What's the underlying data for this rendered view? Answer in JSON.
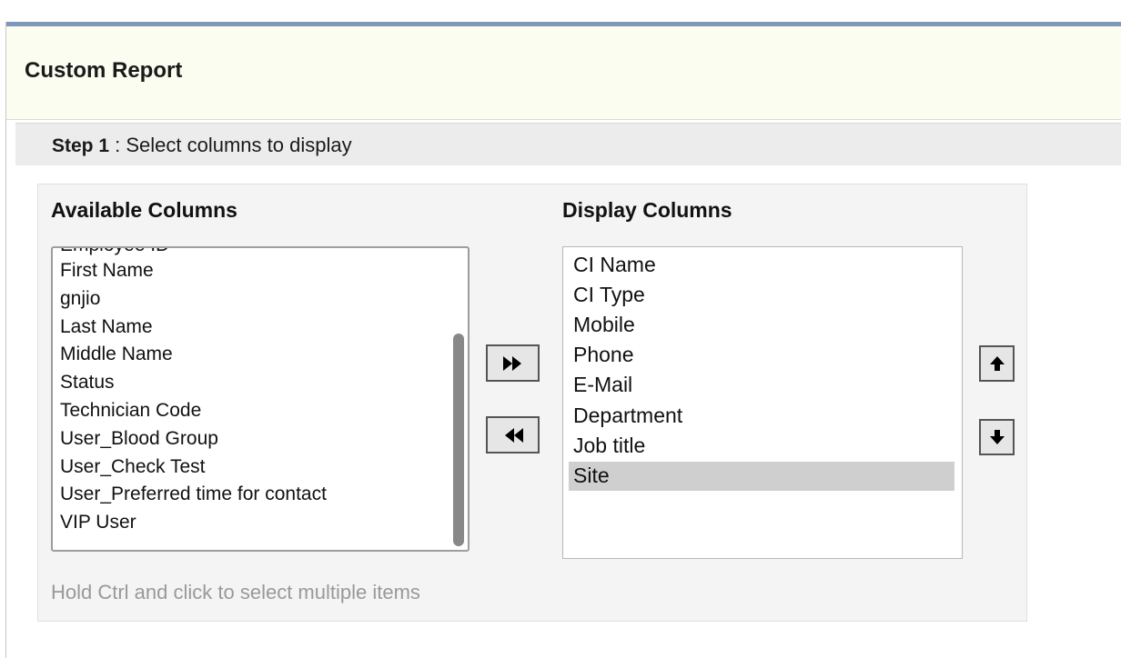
{
  "header": {
    "title": "Custom Report"
  },
  "step": {
    "label": "Step 1",
    "text": " : Select columns to display"
  },
  "available": {
    "heading": "Available Columns",
    "partial_item": "Employee ID",
    "items": [
      "First Name",
      "gnjio",
      "Last Name",
      "Middle Name",
      "Status",
      "Technician Code",
      "User_Blood Group",
      "User_Check Test",
      "User_Preferred time for contact",
      "VIP User"
    ]
  },
  "display": {
    "heading": "Display Columns",
    "items": [
      "CI Name",
      "CI Type",
      "Mobile",
      "Phone",
      "E-Mail",
      "Department",
      "Job title",
      "Site"
    ],
    "selected": "Site"
  },
  "buttons": {
    "add_icon": "double-chevron-right-icon",
    "remove_icon": "double-chevron-left-icon",
    "up_icon": "arrow-up-icon",
    "down_icon": "arrow-down-icon"
  },
  "hint": "Hold Ctrl and click to select multiple items",
  "colors": {
    "accent_bar": "#7f97b8",
    "header_bg": "#fbfdf0",
    "selected_bg": "#cfcfcf"
  }
}
